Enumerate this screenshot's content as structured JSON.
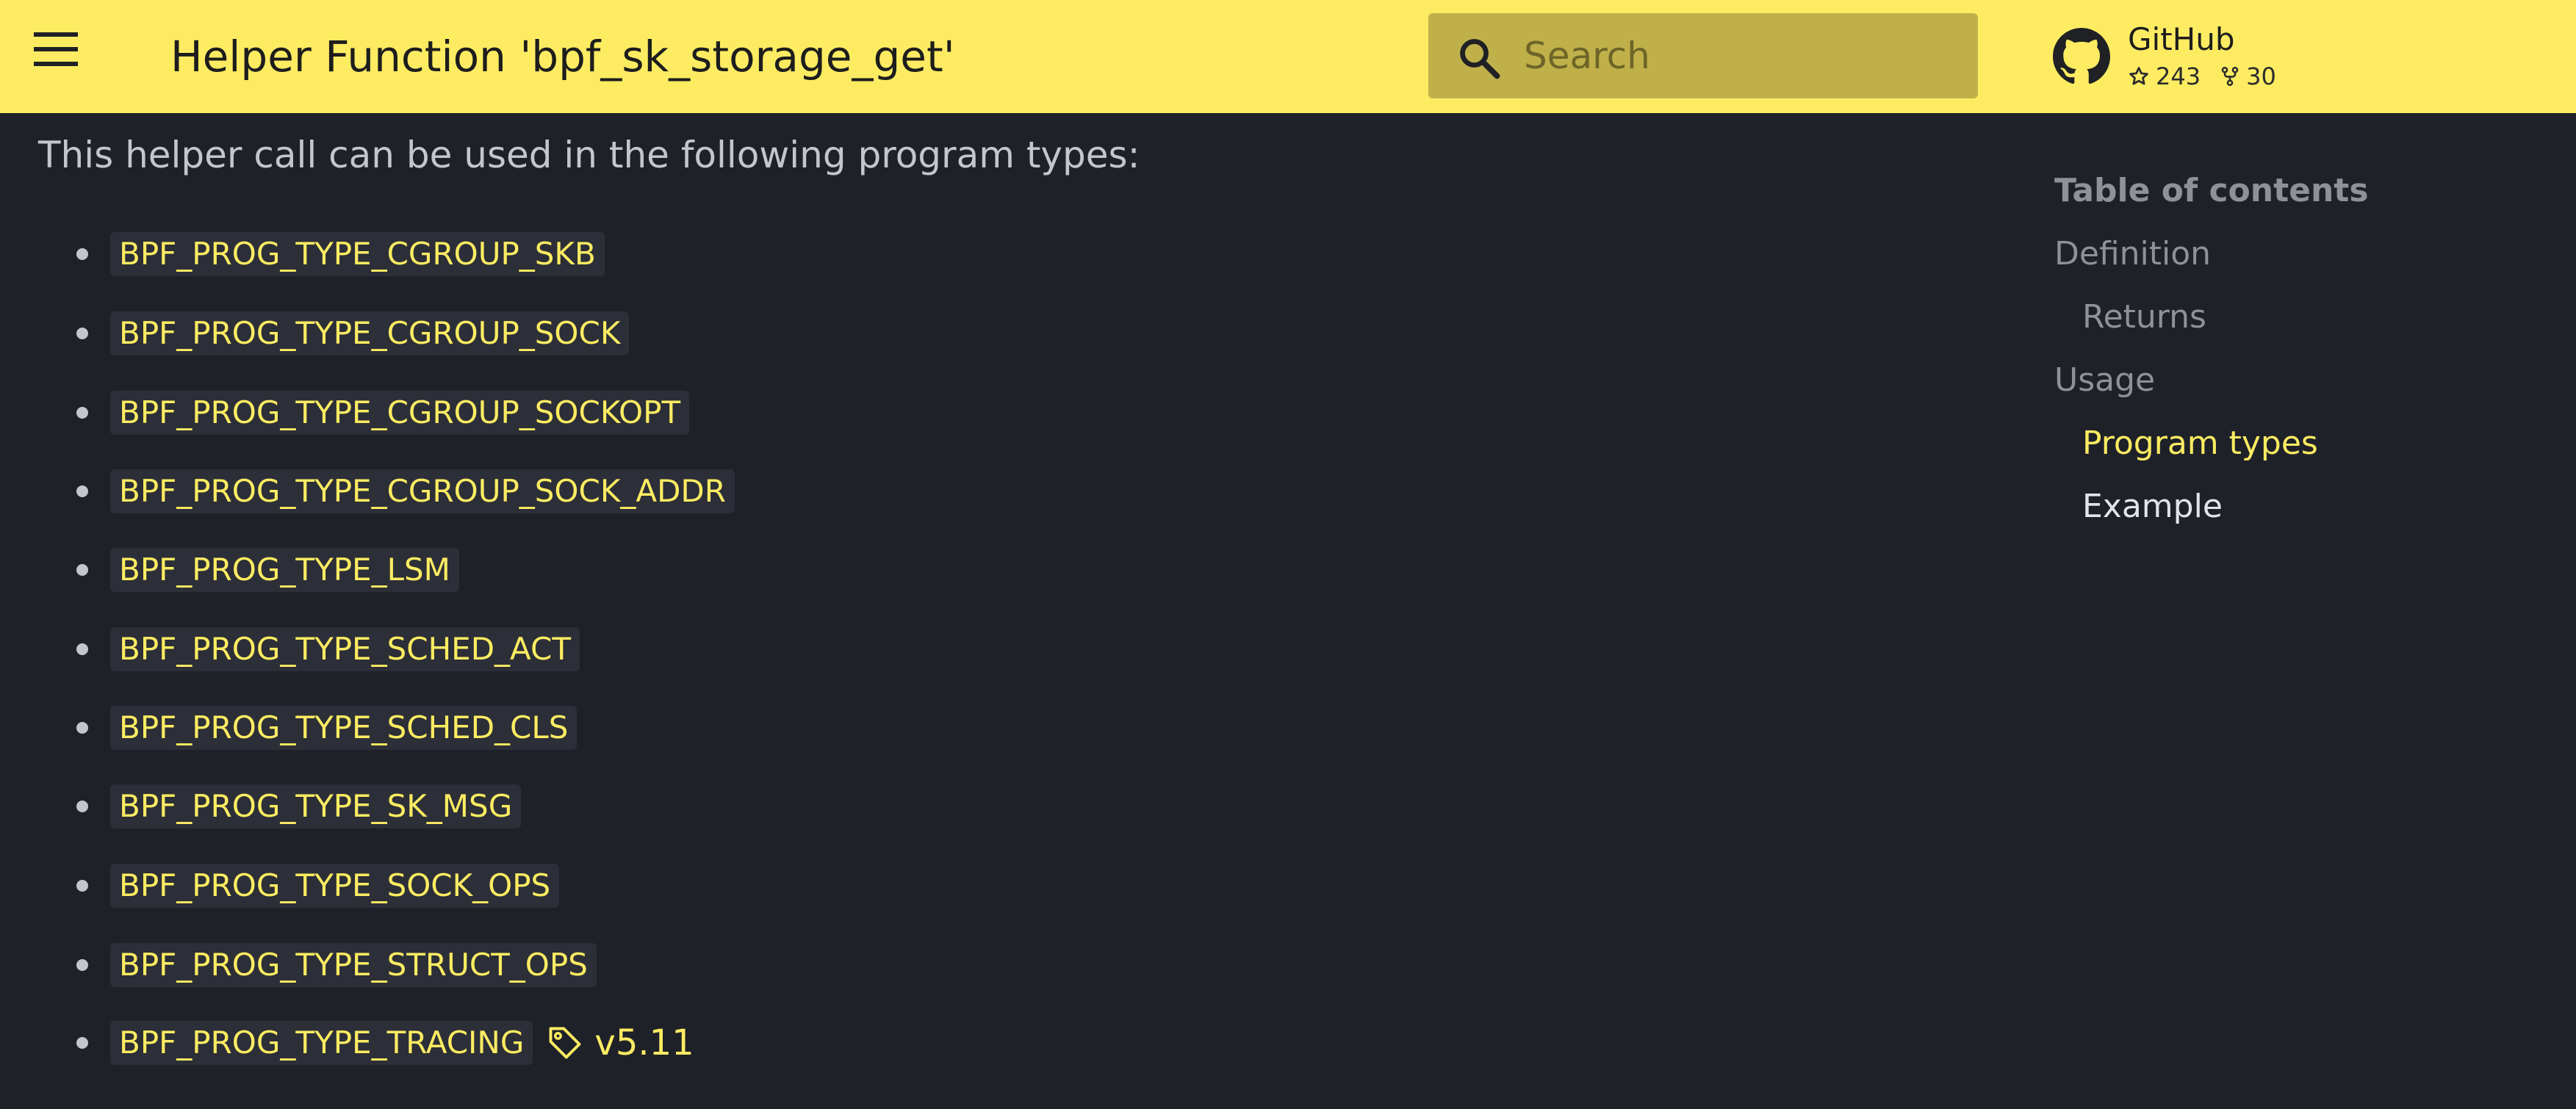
{
  "header": {
    "title": "Helper Function 'bpf_sk_storage_get'",
    "menu_icon": "menu-icon",
    "search": {
      "placeholder": "Search",
      "value": ""
    },
    "repo": {
      "name": "GitHub",
      "stars": "243",
      "forks": "30"
    },
    "colors": {
      "header_bg": "#fdec62",
      "search_bg": "#bfb04a"
    }
  },
  "main": {
    "intro": "This helper call can be used in the following program types:",
    "program_types": [
      {
        "label": "BPF_PROG_TYPE_CGROUP_SKB"
      },
      {
        "label": "BPF_PROG_TYPE_CGROUP_SOCK"
      },
      {
        "label": "BPF_PROG_TYPE_CGROUP_SOCKOPT"
      },
      {
        "label": "BPF_PROG_TYPE_CGROUP_SOCK_ADDR"
      },
      {
        "label": "BPF_PROG_TYPE_LSM"
      },
      {
        "label": "BPF_PROG_TYPE_SCHED_ACT"
      },
      {
        "label": "BPF_PROG_TYPE_SCHED_CLS"
      },
      {
        "label": "BPF_PROG_TYPE_SK_MSG"
      },
      {
        "label": "BPF_PROG_TYPE_SOCK_OPS"
      },
      {
        "label": "BPF_PROG_TYPE_STRUCT_OPS"
      },
      {
        "label": "BPF_PROG_TYPE_TRACING",
        "version": "v5.11"
      }
    ],
    "colors": {
      "background": "#1f2129",
      "code_text": "#fdec62",
      "code_bg": "#2c2f37",
      "body_text": "#c4c6cc"
    }
  },
  "toc": {
    "title": "Table of contents",
    "items": [
      {
        "label": "Definition",
        "level": 1,
        "state": "normal"
      },
      {
        "label": "Returns",
        "level": 2,
        "state": "normal"
      },
      {
        "label": "Usage",
        "level": 1,
        "state": "normal"
      },
      {
        "label": "Program types",
        "level": 2,
        "state": "active"
      },
      {
        "label": "Example",
        "level": 2,
        "state": "highlight"
      }
    ],
    "colors": {
      "normal": "#8f9196",
      "active": "#fdec62",
      "highlight": "#e3e4e8"
    }
  }
}
